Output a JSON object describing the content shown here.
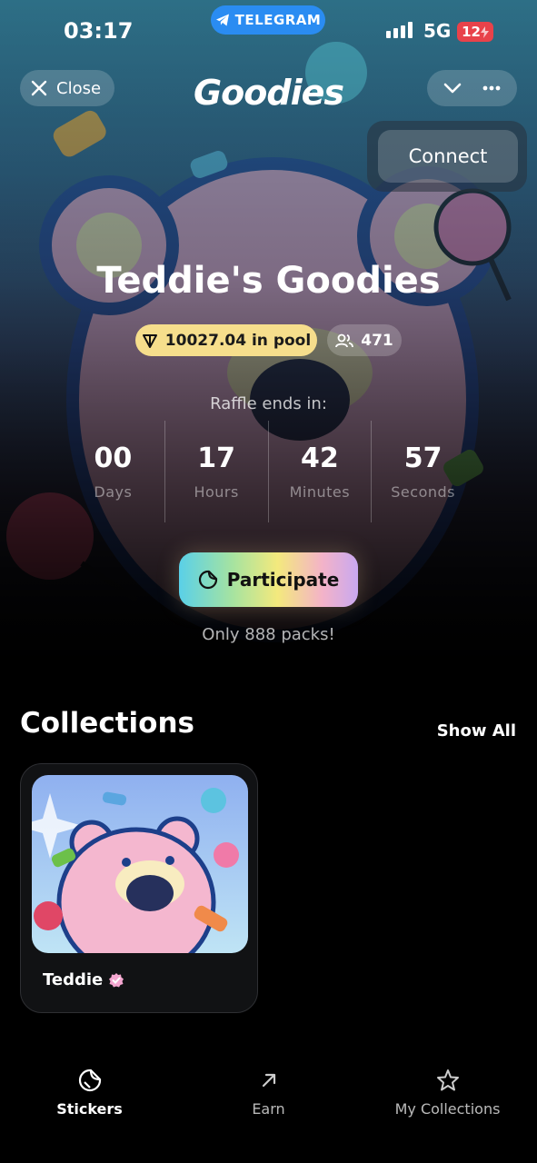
{
  "status_bar": {
    "time": "03:17",
    "telegram_label": "TELEGRAM",
    "network": "5G",
    "battery": "12"
  },
  "header": {
    "close_label": "Close",
    "app_title": "Goodies",
    "connect_label": "Connect",
    "chevron_icon": "chevron-down-icon",
    "more_icon": "more-icon"
  },
  "hero": {
    "title": "Teddie's Goodies",
    "pool": "10027.04 in pool",
    "participants": "471",
    "raffle_label": "Raffle ends in:",
    "countdown": [
      {
        "value": "00",
        "label": "Days"
      },
      {
        "value": "17",
        "label": "Hours"
      },
      {
        "value": "42",
        "label": "Minutes"
      },
      {
        "value": "57",
        "label": "Seconds"
      }
    ],
    "participate_label": "Participate",
    "packs_note": "Only 888 packs!"
  },
  "collections": {
    "title": "Collections",
    "show_all": "Show All",
    "items": [
      {
        "name": "Teddie",
        "verified": true
      }
    ]
  },
  "tabbar": {
    "items": [
      {
        "label": "Stickers",
        "icon": "sticker-icon",
        "active": true
      },
      {
        "label": "Earn",
        "icon": "arrow-up-right-icon",
        "active": false
      },
      {
        "label": "My Collections",
        "icon": "star-icon",
        "active": false
      }
    ]
  },
  "colors": {
    "pool_badge": "#f6de8c",
    "telegram": "#2a8cf2",
    "battery": "#e8424a",
    "verified": "#f4a6d0"
  }
}
